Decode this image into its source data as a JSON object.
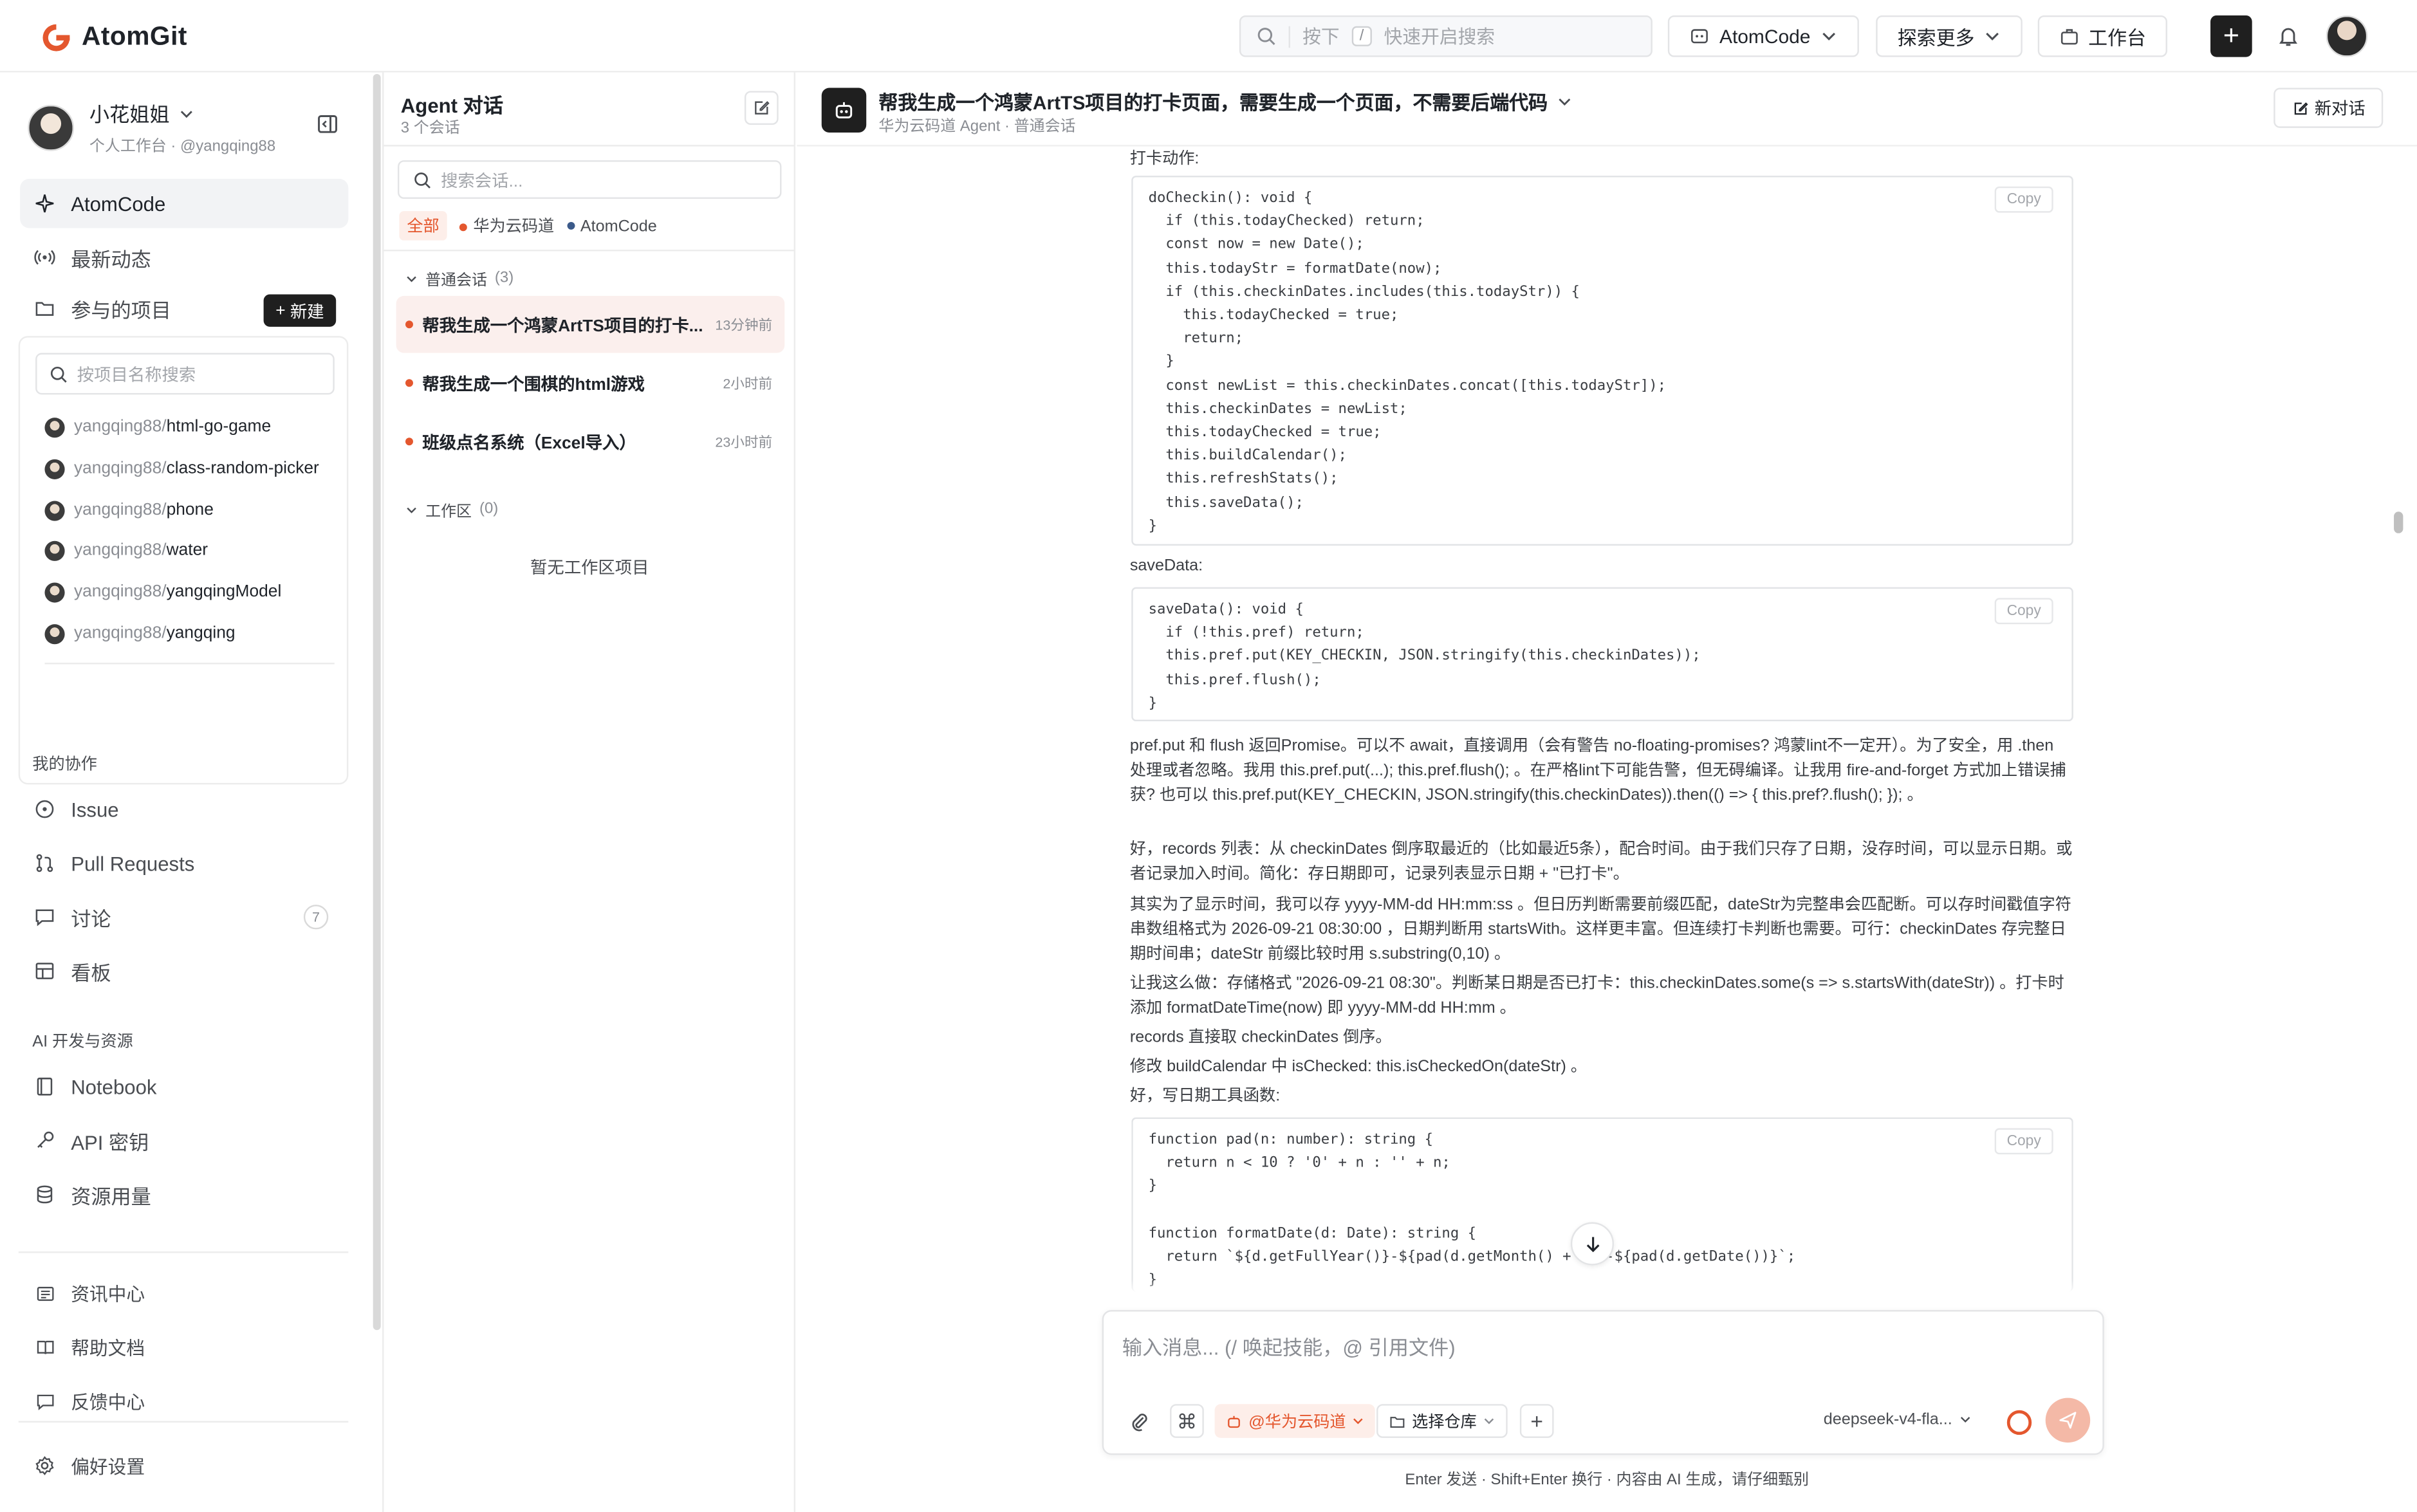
{
  "topbar": {
    "brand": "AtomGit",
    "search_placeholder": "快速开启搜索",
    "search_prefix": "按下",
    "search_key": "/",
    "atomcode_label": "AtomCode",
    "explore_label": "探索更多",
    "workbench_label": "工作台",
    "accent": "#e4572e"
  },
  "sidebar": {
    "user_name": "小花姐姐",
    "user_sub": "个人工作台 · @yangqing88",
    "nav": {
      "atomcode": "AtomCode",
      "activity": "最新动态",
      "projects": "参与的项目",
      "new_label": "新建"
    },
    "project_search_placeholder": "按项目名称搜索",
    "projects": [
      {
        "owner": "yangqing88/",
        "name": "html-go-game"
      },
      {
        "owner": "yangqing88/",
        "name": "class-random-picker"
      },
      {
        "owner": "yangqing88/",
        "name": "phone"
      },
      {
        "owner": "yangqing88/",
        "name": "water"
      },
      {
        "owner": "yangqing88/",
        "name": "yangqingModel"
      },
      {
        "owner": "yangqing88/",
        "name": "yangqing"
      }
    ],
    "collab_title": "我的协作",
    "collab": [
      "Issue",
      "Pull Requests",
      "讨论",
      "看板"
    ],
    "discuss_count": "7",
    "ai_title": "AI 开发与资源",
    "ai": [
      "Notebook",
      "API 密钥",
      "资源用量"
    ],
    "footer": [
      "资讯中心",
      "帮助文档",
      "反馈中心"
    ],
    "settings": "偏好设置"
  },
  "conv": {
    "title": "Agent 对话",
    "sub": "3 个会话",
    "search_placeholder": "搜索会话...",
    "filters": [
      "全部",
      "华为云码道",
      "AtomCode"
    ],
    "group_normal": "普通会话",
    "group_normal_count": "(3)",
    "items": [
      {
        "title": "帮我生成一个鸿蒙ArtTS项目的打卡...",
        "time": "13分钟前"
      },
      {
        "title": "帮我生成一个围棋的html游戏",
        "time": "2小时前"
      },
      {
        "title": "班级点名系统（Excel导入）",
        "time": "23小时前"
      }
    ],
    "group_ws": "工作区",
    "group_ws_count": "(0)",
    "empty": "暂无工作区项目"
  },
  "chat": {
    "title": "帮我生成一个鸿蒙ArtTS项目的打卡页面，需要生成一个页面，不需要后端代码",
    "sub": "华为云码道 Agent · 普通会话",
    "new_chat": "新对话",
    "copy_label": "Copy",
    "label_checkin": "打卡动作:",
    "code_checkin": "doCheckin(): void {\n  if (this.todayChecked) return;\n  const now = new Date();\n  this.todayStr = formatDate(now);\n  if (this.checkinDates.includes(this.todayStr)) {\n    this.todayChecked = true;\n    return;\n  }\n  const newList = this.checkinDates.concat([this.todayStr]);\n  this.checkinDates = newList;\n  this.todayChecked = true;\n  this.buildCalendar();\n  this.refreshStats();\n  this.saveData();\n}",
    "label_save": "saveData:",
    "code_save": "saveData(): void {\n  if (!this.pref) return;\n  this.pref.put(KEY_CHECKIN, JSON.stringify(this.checkinDates));\n  this.pref.flush();\n}",
    "p1": "pref.put 和 flush 返回Promise。可以不 await，直接调用（会有警告 no-floating-promises? 鸿蒙lint不一定开）。为了安全，用 .then 处理或者忽略。我用 this.pref.put(...); this.pref.flush(); 。在严格lint下可能告警，但无碍编译。让我用 fire-and-forget 方式加上错误捕获? 也可以 this.pref.put(KEY_CHECKIN, JSON.stringify(this.checkinDates)).then(() => { this.pref?.flush(); }); 。",
    "p2": "好，records 列表：从 checkinDates 倒序取最近的（比如最近5条），配合时间。由于我们只存了日期，没存时间，可以显示日期。或者记录加入时间。简化：存日期即可，记录列表显示日期 + \"已打卡\"。",
    "p3": "其实为了显示时间，我可以存 yyyy-MM-dd HH:mm:ss 。但日历判断需要前缀匹配，dateStr为完整串会匹配断。可以存时间戳值字符串数组格式为 2026-09-21 08:30:00 ，日期判断用 startsWith。这样更丰富。但连续打卡判断也需要。可行：checkinDates 存完整日期时间串；dateStr 前缀比较时用 s.substring(0,10) 。",
    "p4": "让我这么做：存储格式 \"2026-09-21 08:30\"。判断某日期是否已打卡：this.checkinDates.some(s => s.startsWith(dateStr)) 。打卡时添加 formatDateTime(now) 即 yyyy-MM-dd HH:mm 。",
    "p5": "records 直接取 checkinDates 倒序。",
    "p6": "修改 buildCalendar 中 isChecked: this.isCheckedOn(dateStr) 。",
    "p7": "好，写日期工具函数:",
    "code_util": "function pad(n: number): string {\n  return n < 10 ? '0' + n : '' + n;\n}\n\nfunction formatDate(d: Date): string {\n  return `${d.getFullYear()}-${pad(d.getMonth() + 1)}-${pad(d.getDate())}`;\n}"
  },
  "composer": {
    "placeholder": "输入消息...   (/ 唤起技能，@ 引用文件)",
    "agent_tag": "@华为云码道",
    "repo_tag": "选择仓库",
    "model": "deepseek-v4-fla...",
    "hint": "Enter 发送 · Shift+Enter 换行 · 内容由 AI 生成，请仔细甄别"
  }
}
